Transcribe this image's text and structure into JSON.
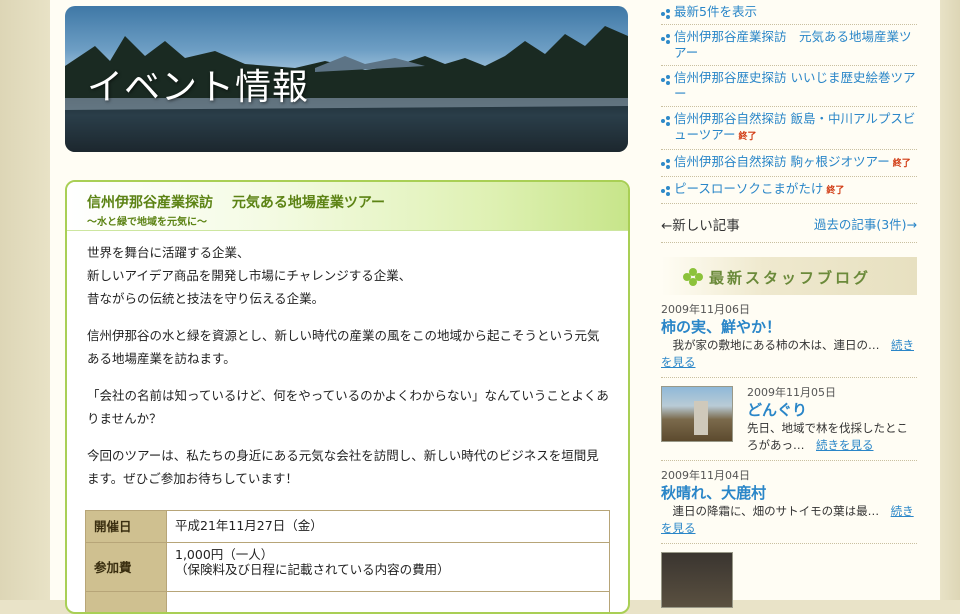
{
  "banner": {
    "title": "イベント情報"
  },
  "article": {
    "title": "信州伊那谷産業探訪　 元気ある地場産業ツアー",
    "subtitle": "～水と緑で地域を元気に～",
    "paragraphs": [
      [
        "世界を舞台に活躍する企業、",
        "新しいアイデア商品を開発し市場にチャレンジする企業、",
        "昔ながらの伝統と技法を守り伝える企業。"
      ],
      [
        "信州伊那谷の水と緑を資源とし、新しい時代の産業の風をこの地域から起こそうという元気ある地場産業を訪ねます。"
      ],
      [
        "「会社の名前は知っているけど、何をやっているのかよくわからない」なんていうことよくありませんか？"
      ],
      [
        "今回のツアーは、私たちの身近にある元気な会社を訪問し、新しい時代のビジネスを垣間見ます。ぜひご参加お待ちしています！"
      ]
    ],
    "info": [
      {
        "key": "開催日",
        "value": "平成21年11月27日（金）"
      },
      {
        "key": "参加費",
        "value": "1,000円（一人）",
        "value2": "（保険料及び日程に記載されている内容の費用）"
      }
    ]
  },
  "sidebar": {
    "links": [
      {
        "text": "最新5件を表示",
        "tag": ""
      },
      {
        "text": "信州伊那谷産業探訪　元気ある地場産業ツアー",
        "tag": ""
      },
      {
        "text": "信州伊那谷歴史探訪 いいじま歴史絵巻ツアー",
        "tag": ""
      },
      {
        "text": "信州伊那谷自然探訪 飯島・中川アルプスビューツアー",
        "tag": "終了"
      },
      {
        "text": "信州伊那谷自然探訪 駒ヶ根ジオツアー",
        "tag": "終了"
      },
      {
        "text": "ピースローソクこまがたけ",
        "tag": "終了"
      }
    ],
    "pager": {
      "prev": "←新しい記事",
      "next": "過去の記事(3件)→"
    },
    "blog_heading": "最新スタッフブログ",
    "posts": [
      {
        "date": "2009年11月06日",
        "title": "柿の実、鮮やか！",
        "excerpt": "　我が家の敷地にある柿の木は、連日の…",
        "more": "続きを見る"
      },
      {
        "date": "2009年11月05日",
        "title": "どんぐり",
        "excerpt": "先日、地域で林を伐採したところがあっ…",
        "more": "続きを見る"
      },
      {
        "date": "2009年11月04日",
        "title": "秋晴れ、大鹿村",
        "excerpt": "　連日の降霜に、畑のサトイモの葉は最…",
        "more": "続きを見る"
      }
    ]
  }
}
